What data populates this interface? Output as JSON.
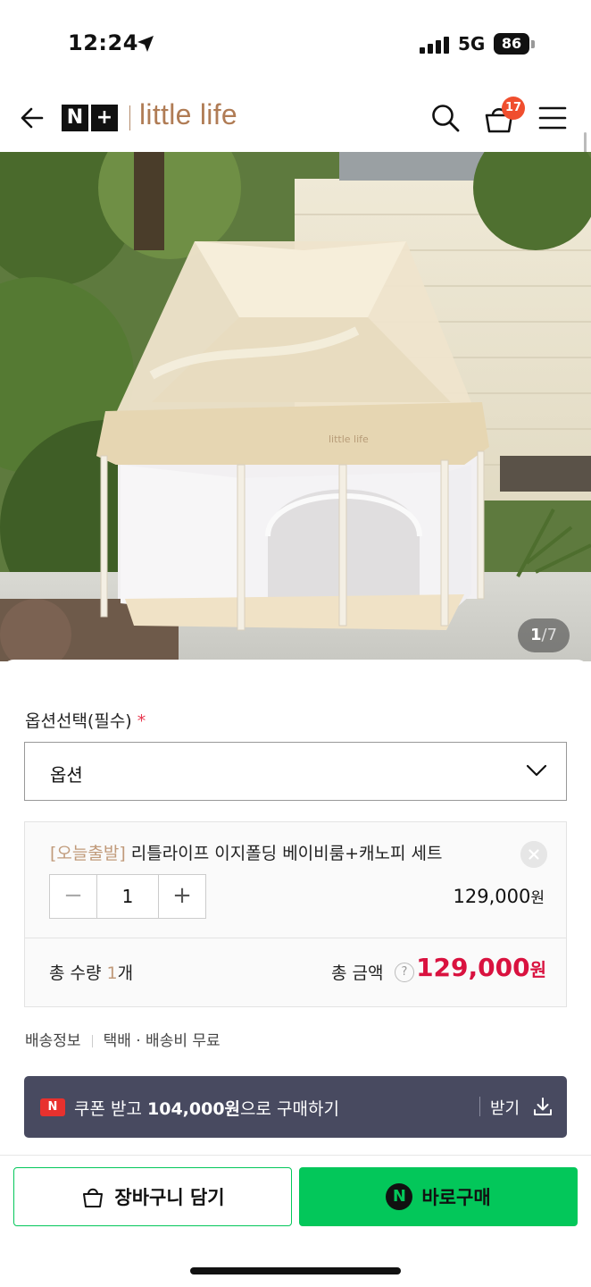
{
  "status_bar": {
    "time": "12:24",
    "network": "5G",
    "battery": "86"
  },
  "header": {
    "logo_letters": [
      "N",
      "+"
    ],
    "brand": "little life",
    "cart_count": "17",
    "icons": [
      "back-arrow-icon",
      "search-icon",
      "shopping-basket-icon",
      "hamburger-menu-icon"
    ]
  },
  "gallery": {
    "current": "1",
    "separator": "/",
    "total": "7",
    "product_print": "little life"
  },
  "option": {
    "label": "옵션선택(필수)",
    "required_mark": "*",
    "select_value": "옵션"
  },
  "selected_item": {
    "tag": "[오늘출발]",
    "name": "리틀라이프 이지폴딩 베이비룸+캐노피 세트",
    "stepper": {
      "minus": "−",
      "quantity": "1",
      "plus": "+"
    },
    "price": "129,000",
    "currency": "원"
  },
  "totals": {
    "qty_label": "총 수량",
    "qty_value": "1",
    "qty_unit": "개",
    "amount_label": "총 금액",
    "help_glyph": "?",
    "amount": "129,000",
    "currency": "원"
  },
  "shipping": {
    "label": "배송정보",
    "value": "택배 · 배송비 무료"
  },
  "coupon": {
    "badge": "N",
    "prefix": "쿠폰 받고 ",
    "amount": "104,000원",
    "suffix": "으로 구매하기",
    "action": "받기"
  },
  "actions": {
    "cart_label": "장바구니 담기",
    "buy_badge": "N",
    "buy_label": "바로구매"
  },
  "colors": {
    "accent_green": "#03c75a",
    "price_red": "#d9123f",
    "brand_brown": "#b07c55",
    "coupon_bg": "#484a60",
    "badge_red": "#f04e2e"
  }
}
